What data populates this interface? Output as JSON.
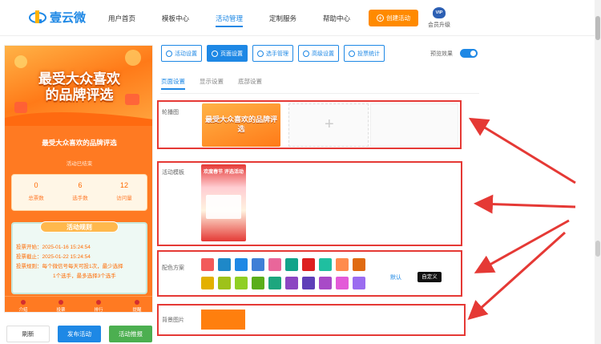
{
  "header": {
    "logo_text": "壹云微",
    "nav": [
      "用户首页",
      "模板中心",
      "活动管理",
      "定制服务",
      "帮助中心"
    ],
    "create_button": "创建活动",
    "vip_badge": "VIP",
    "vip_label": "会员升级"
  },
  "preview": {
    "banner_title_line1": "最受大众喜欢",
    "banner_title_line2": "的品牌评选",
    "title": "最受大众喜欢的品牌评选",
    "status": "活动已结束",
    "stats": [
      {
        "value": "0",
        "label": "总票数"
      },
      {
        "value": "6",
        "label": "选手数"
      },
      {
        "value": "12",
        "label": "访问量"
      }
    ],
    "rules_title": "活动规则",
    "rules": [
      "投票开始：2025-01-16 15:24:54",
      "投票截止：2025-01-22 15:24:54",
      "投票规则：每个微信号每天可投1次，最少选择",
      "1个选手，最多选择3个选手"
    ],
    "tabbar": [
      "介绍",
      "投票",
      "排行",
      "提醒"
    ]
  },
  "actions": {
    "refresh": "刷新",
    "publish": "发布活动",
    "promote": "活动推报"
  },
  "toolbar": {
    "tabs": [
      "活动设置",
      "页面设置",
      "选手管理",
      "高级设置",
      "投票统计"
    ],
    "active_index": 1,
    "preview_label": "预览效果",
    "preview_on": true
  },
  "subtabs": {
    "items": [
      "页面设置",
      "显示设置",
      "底部设置"
    ],
    "active_index": 0
  },
  "settings": {
    "carousel_label": "轮播图",
    "carousel_thumb_text": "最受大众喜欢的品牌评选",
    "template_label": "活动模板",
    "template_thumb_text": "欢度春节 评选活动",
    "color_label": "配色方案",
    "color_default": "默认",
    "color_custom": "自定义",
    "colors_row1": [
      "#f25a5a",
      "#1e88c8",
      "#1e88e5",
      "#3f7fd6",
      "#e9669a",
      "#12a38a",
      "#dd1f1f",
      "#1fbfa0",
      "#ff8b4d",
      "#e06a10"
    ],
    "colors_row2": [
      "#e3b000",
      "#9ec21a",
      "#8fcf24",
      "#5aae1a",
      "#1da67e",
      "#8c46c2",
      "#5f3fb8",
      "#a84ac7",
      "#e35ad8",
      "#9b6cf0"
    ],
    "bg_label": "背景图片",
    "bg_color": "#ff7f0e"
  }
}
